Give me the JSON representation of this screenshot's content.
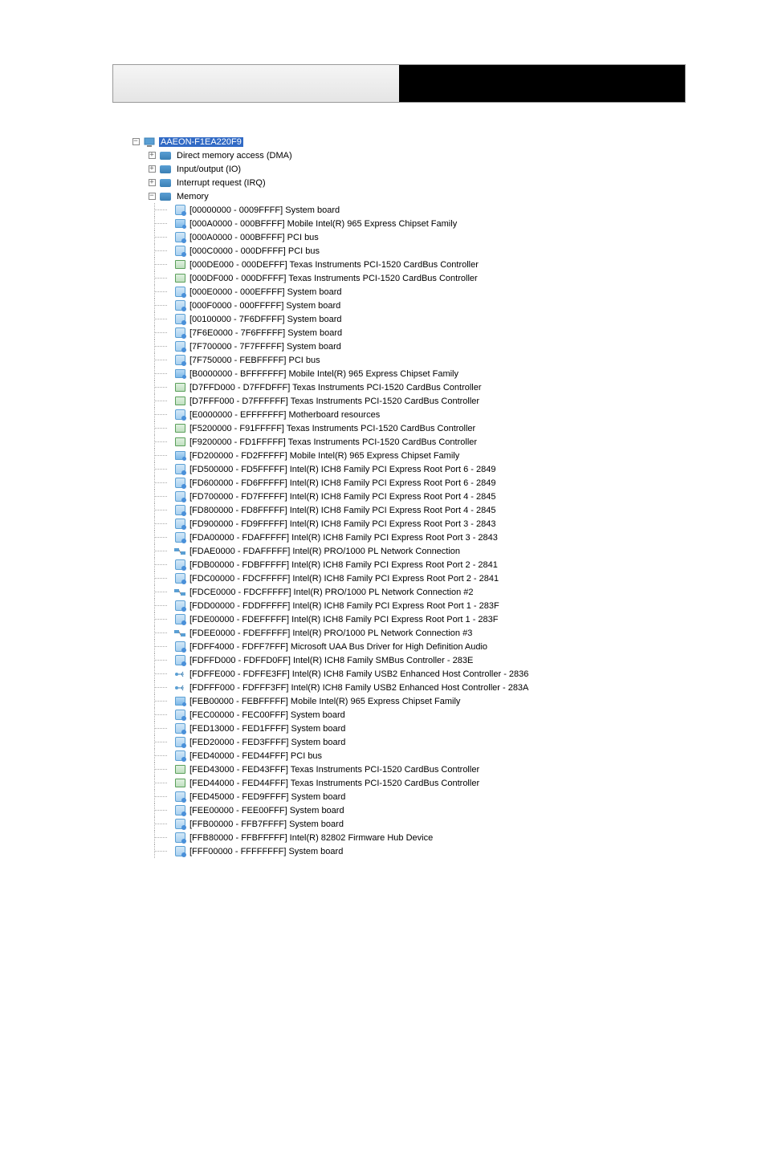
{
  "root": {
    "name": "AAEON-F1EA220F9"
  },
  "categories": [
    {
      "label": "Direct memory access (DMA)",
      "expanded": false
    },
    {
      "label": "Input/output (IO)",
      "expanded": false
    },
    {
      "label": "Interrupt request (IRQ)",
      "expanded": false
    },
    {
      "label": "Memory",
      "expanded": true
    }
  ],
  "memory_items": [
    {
      "range": "[00000000 - 0009FFFF]",
      "device": "System board",
      "icon": "card"
    },
    {
      "range": "[000A0000 - 000BFFFF]",
      "device": "Mobile Intel(R) 965 Express Chipset Family",
      "icon": "display"
    },
    {
      "range": "[000A0000 - 000BFFFF]",
      "device": "PCI bus",
      "icon": "card"
    },
    {
      "range": "[000C0000 - 000DFFFF]",
      "device": "PCI bus",
      "icon": "card"
    },
    {
      "range": "[000DE000 - 000DEFFF]",
      "device": "Texas Instruments PCI-1520 CardBus Controller",
      "icon": "green"
    },
    {
      "range": "[000DF000 - 000DFFFF]",
      "device": "Texas Instruments PCI-1520 CardBus Controller",
      "icon": "green"
    },
    {
      "range": "[000E0000 - 000EFFFF]",
      "device": "System board",
      "icon": "card"
    },
    {
      "range": "[000F0000 - 000FFFFF]",
      "device": "System board",
      "icon": "card"
    },
    {
      "range": "[00100000 - 7F6DFFFF]",
      "device": "System board",
      "icon": "card"
    },
    {
      "range": "[7F6E0000 - 7F6FFFFF]",
      "device": "System board",
      "icon": "card"
    },
    {
      "range": "[7F700000 - 7F7FFFFF]",
      "device": "System board",
      "icon": "card"
    },
    {
      "range": "[7F750000 - FEBFFFFF]",
      "device": "PCI bus",
      "icon": "card"
    },
    {
      "range": "[B0000000 - BFFFFFFF]",
      "device": "Mobile Intel(R) 965 Express Chipset Family",
      "icon": "display"
    },
    {
      "range": "[D7FFD000 - D7FFDFFF]",
      "device": "Texas Instruments PCI-1520 CardBus Controller",
      "icon": "green"
    },
    {
      "range": "[D7FFF000 - D7FFFFFF]",
      "device": "Texas Instruments PCI-1520 CardBus Controller",
      "icon": "green"
    },
    {
      "range": "[E0000000 - EFFFFFFF]",
      "device": "Motherboard resources",
      "icon": "card"
    },
    {
      "range": "[F5200000 - F91FFFFF]",
      "device": "Texas Instruments PCI-1520 CardBus Controller",
      "icon": "green"
    },
    {
      "range": "[F9200000 - FD1FFFFF]",
      "device": "Texas Instruments PCI-1520 CardBus Controller",
      "icon": "green"
    },
    {
      "range": "[FD200000 - FD2FFFFF]",
      "device": "Mobile Intel(R) 965 Express Chipset Family",
      "icon": "display"
    },
    {
      "range": "[FD500000 - FD5FFFFF]",
      "device": "Intel(R) ICH8 Family PCI Express Root Port 6 - 2849",
      "icon": "card"
    },
    {
      "range": "[FD600000 - FD6FFFFF]",
      "device": "Intel(R) ICH8 Family PCI Express Root Port 6 - 2849",
      "icon": "card"
    },
    {
      "range": "[FD700000 - FD7FFFFF]",
      "device": "Intel(R) ICH8 Family PCI Express Root Port 4 - 2845",
      "icon": "card"
    },
    {
      "range": "[FD800000 - FD8FFFFF]",
      "device": "Intel(R) ICH8 Family PCI Express Root Port 4 - 2845",
      "icon": "card"
    },
    {
      "range": "[FD900000 - FD9FFFFF]",
      "device": "Intel(R) ICH8 Family PCI Express Root Port 3 - 2843",
      "icon": "card"
    },
    {
      "range": "[FDA00000 - FDAFFFFF]",
      "device": "Intel(R) ICH8 Family PCI Express Root Port 3 - 2843",
      "icon": "card"
    },
    {
      "range": "[FDAE0000 - FDAFFFFF]",
      "device": "Intel(R) PRO/1000 PL Network Connection",
      "icon": "network"
    },
    {
      "range": "[FDB00000 - FDBFFFFF]",
      "device": "Intel(R) ICH8 Family PCI Express Root Port 2 - 2841",
      "icon": "card"
    },
    {
      "range": "[FDC00000 - FDCFFFFF]",
      "device": "Intel(R) ICH8 Family PCI Express Root Port 2 - 2841",
      "icon": "card"
    },
    {
      "range": "[FDCE0000 - FDCFFFFF]",
      "device": "Intel(R) PRO/1000 PL Network Connection #2",
      "icon": "network"
    },
    {
      "range": "[FDD00000 - FDDFFFFF]",
      "device": "Intel(R) ICH8 Family PCI Express Root Port 1 - 283F",
      "icon": "card"
    },
    {
      "range": "[FDE00000 - FDEFFFFF]",
      "device": "Intel(R) ICH8 Family PCI Express Root Port 1 - 283F",
      "icon": "card"
    },
    {
      "range": "[FDEE0000 - FDEFFFFF]",
      "device": "Intel(R) PRO/1000 PL Network Connection #3",
      "icon": "network"
    },
    {
      "range": "[FDFF4000 - FDFF7FFF]",
      "device": "Microsoft UAA Bus Driver for High Definition Audio",
      "icon": "card"
    },
    {
      "range": "[FDFFD000 - FDFFD0FF]",
      "device": "Intel(R) ICH8 Family SMBus Controller - 283E",
      "icon": "card"
    },
    {
      "range": "[FDFFE000 - FDFFE3FF]",
      "device": "Intel(R) ICH8 Family USB2 Enhanced Host Controller - 2836",
      "icon": "usb"
    },
    {
      "range": "[FDFFF000 - FDFFF3FF]",
      "device": "Intel(R) ICH8 Family USB2 Enhanced Host Controller - 283A",
      "icon": "usb"
    },
    {
      "range": "[FEB00000 - FEBFFFFF]",
      "device": "Mobile Intel(R) 965 Express Chipset Family",
      "icon": "display"
    },
    {
      "range": "[FEC00000 - FEC00FFF]",
      "device": "System board",
      "icon": "card"
    },
    {
      "range": "[FED13000 - FED1FFFF]",
      "device": "System board",
      "icon": "card"
    },
    {
      "range": "[FED20000 - FED3FFFF]",
      "device": "System board",
      "icon": "card"
    },
    {
      "range": "[FED40000 - FED44FFF]",
      "device": "PCI bus",
      "icon": "card"
    },
    {
      "range": "[FED43000 - FED43FFF]",
      "device": "Texas Instruments PCI-1520 CardBus Controller",
      "icon": "green"
    },
    {
      "range": "[FED44000 - FED44FFF]",
      "device": "Texas Instruments PCI-1520 CardBus Controller",
      "icon": "green"
    },
    {
      "range": "[FED45000 - FED9FFFF]",
      "device": "System board",
      "icon": "card"
    },
    {
      "range": "[FEE00000 - FEE00FFF]",
      "device": "System board",
      "icon": "card"
    },
    {
      "range": "[FFB00000 - FFB7FFFF]",
      "device": "System board",
      "icon": "card"
    },
    {
      "range": "[FFB80000 - FFBFFFFF]",
      "device": "Intel(R) 82802 Firmware Hub Device",
      "icon": "card"
    },
    {
      "range": "[FFF00000 - FFFFFFFF]",
      "device": "System board",
      "icon": "card"
    }
  ]
}
